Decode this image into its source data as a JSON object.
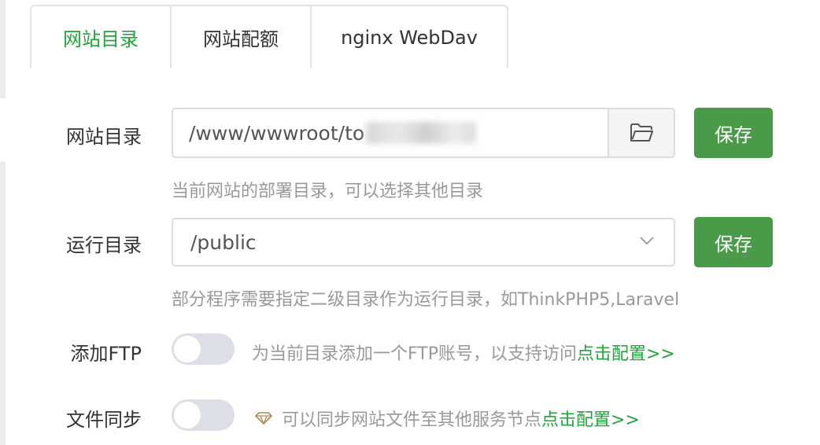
{
  "tabs": [
    {
      "label": "网站目录",
      "active": true
    },
    {
      "label": "网站配额",
      "active": false
    },
    {
      "label": "nginx WebDav",
      "active": false
    }
  ],
  "site_dir": {
    "label": "网站目录",
    "value_prefix": "/www/wwwroot/to",
    "hint": "当前网站的部署目录，可以选择其他目录",
    "save_label": "保存",
    "folder_icon": "folder-icon"
  },
  "run_dir": {
    "label": "运行目录",
    "selected": "/public",
    "hint": "部分程序需要指定二级目录作为运行目录，如ThinkPHP5,Laravel",
    "save_label": "保存"
  },
  "ftp": {
    "label": "添加FTP",
    "enabled": false,
    "desc": "为当前目录添加一个FTP账号，以支持访问",
    "link": "点击配置>>"
  },
  "sync": {
    "label": "文件同步",
    "enabled": false,
    "desc": "可以同步网站文件至其他服务节点",
    "link": "点击配置>>",
    "icon": "gem-icon"
  },
  "colors": {
    "accent": "#20a53a",
    "save_button": "#4a9a4a",
    "hint": "#999999",
    "toggle_off": "#dcdfe6"
  }
}
